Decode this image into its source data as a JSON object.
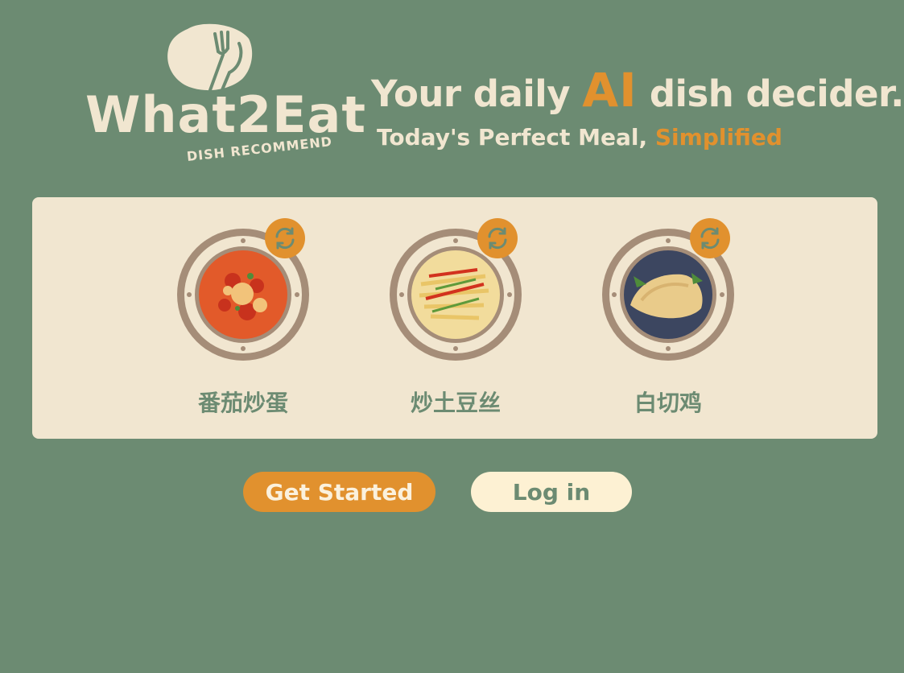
{
  "brand": {
    "name": "What2Eat",
    "subtitle": "DISH RECOMMEND",
    "icon": "fork-knife-icon"
  },
  "hero": {
    "headline_prefix": "Your daily",
    "headline_accent": "AI",
    "headline_suffix": "dish decider.",
    "tagline_prefix": "Today's Perfect Meal,",
    "tagline_accent": "Simplified"
  },
  "dishes": [
    {
      "name": "番茄炒蛋",
      "refresh_icon": "refresh-icon"
    },
    {
      "name": "炒土豆丝",
      "refresh_icon": "refresh-icon"
    },
    {
      "name": "白切鸡",
      "refresh_icon": "refresh-icon"
    }
  ],
  "actions": {
    "get_started": "Get Started",
    "log_in": "Log in"
  },
  "colors": {
    "background": "#6c8b72",
    "panel": "#f1e6d0",
    "accent": "#e1912e",
    "plate_rim": "#a58d78"
  }
}
